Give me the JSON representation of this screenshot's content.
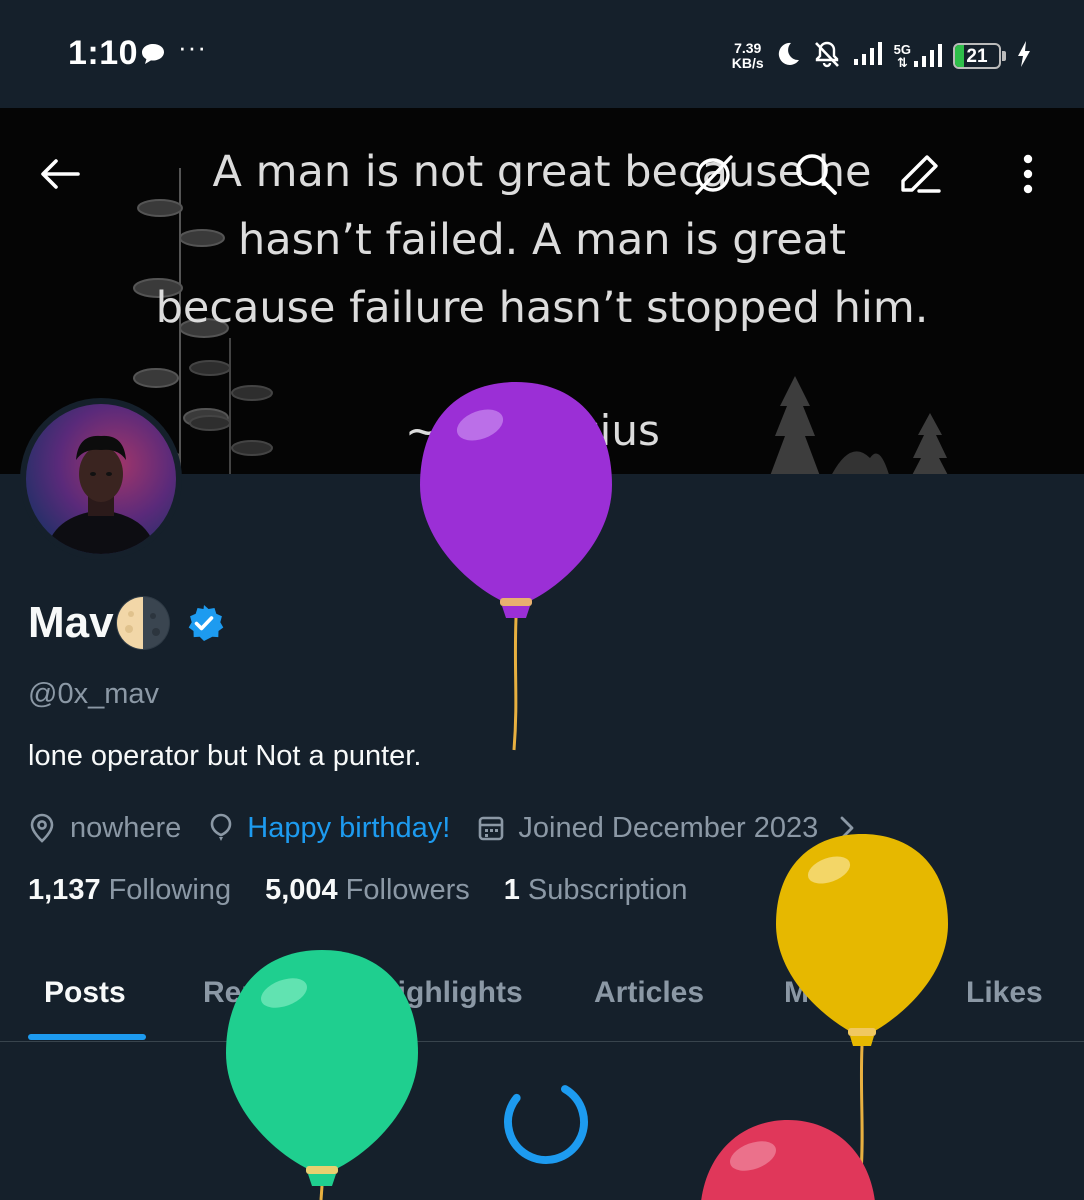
{
  "status_bar": {
    "time": "1:10",
    "more": "···",
    "speed_value": "7.39",
    "speed_unit": "KB/s",
    "network": "5G",
    "battery": "21",
    "battery_level": 0.21
  },
  "banner": {
    "quote_lines": [
      "A man is not great because he",
      "hasn’t failed. A man is great",
      "because failure hasn’t stopped him."
    ],
    "author": "~ Confucius"
  },
  "profile": {
    "display_name": "Mav",
    "handle": "@0x_mav",
    "bio": "lone operator but Not a punter.",
    "location": "nowhere",
    "birthday": "Happy birthday!",
    "joined": "Joined December 2023",
    "following_count": "1,137",
    "following_label": "Following",
    "followers_count": "5,004",
    "followers_label": "Followers",
    "subscriptions_count": "1",
    "subscriptions_label": "Subscription"
  },
  "tabs": [
    "Posts",
    "Replies",
    "Highlights",
    "Articles",
    "Media",
    "Likes"
  ],
  "active_tab": "Posts",
  "colors": {
    "background": "#15202b",
    "accent": "#1d9bf0",
    "muted": "#8b98a5",
    "balloon_purple": "#9b2fd6",
    "balloon_yellow": "#e6b800",
    "balloon_green": "#1fcf8f",
    "balloon_red": "#e0375a"
  }
}
